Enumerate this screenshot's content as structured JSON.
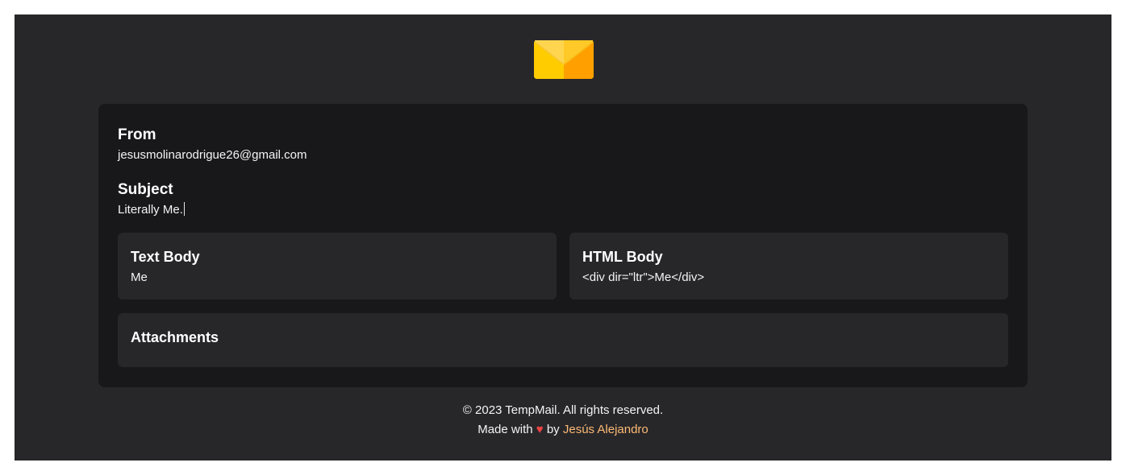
{
  "email": {
    "from_label": "From",
    "from_value": "jesusmolinarodrigue26@gmail.com",
    "subject_label": "Subject",
    "subject_value": "Literally Me."
  },
  "text_body": {
    "label": "Text Body",
    "value": "Me"
  },
  "html_body": {
    "label": "HTML Body",
    "value": "<div dir=\"ltr\">Me</div>"
  },
  "attachments": {
    "label": "Attachments"
  },
  "footer": {
    "copyright": "© 2023 TempMail. All rights reserved.",
    "made_with": "Made with",
    "heart": "♥",
    "by": "by",
    "author": "Jesús Alejandro"
  },
  "colors": {
    "page_background": "#27272a",
    "card_background": "#18181b",
    "panel_background": "#27272a",
    "accent_link": "#fdba74",
    "heart": "#ef4444",
    "envelope_yellow": "#ffcc00",
    "envelope_orange": "#ffa000"
  },
  "icons": {
    "logo": "envelope-icon"
  }
}
